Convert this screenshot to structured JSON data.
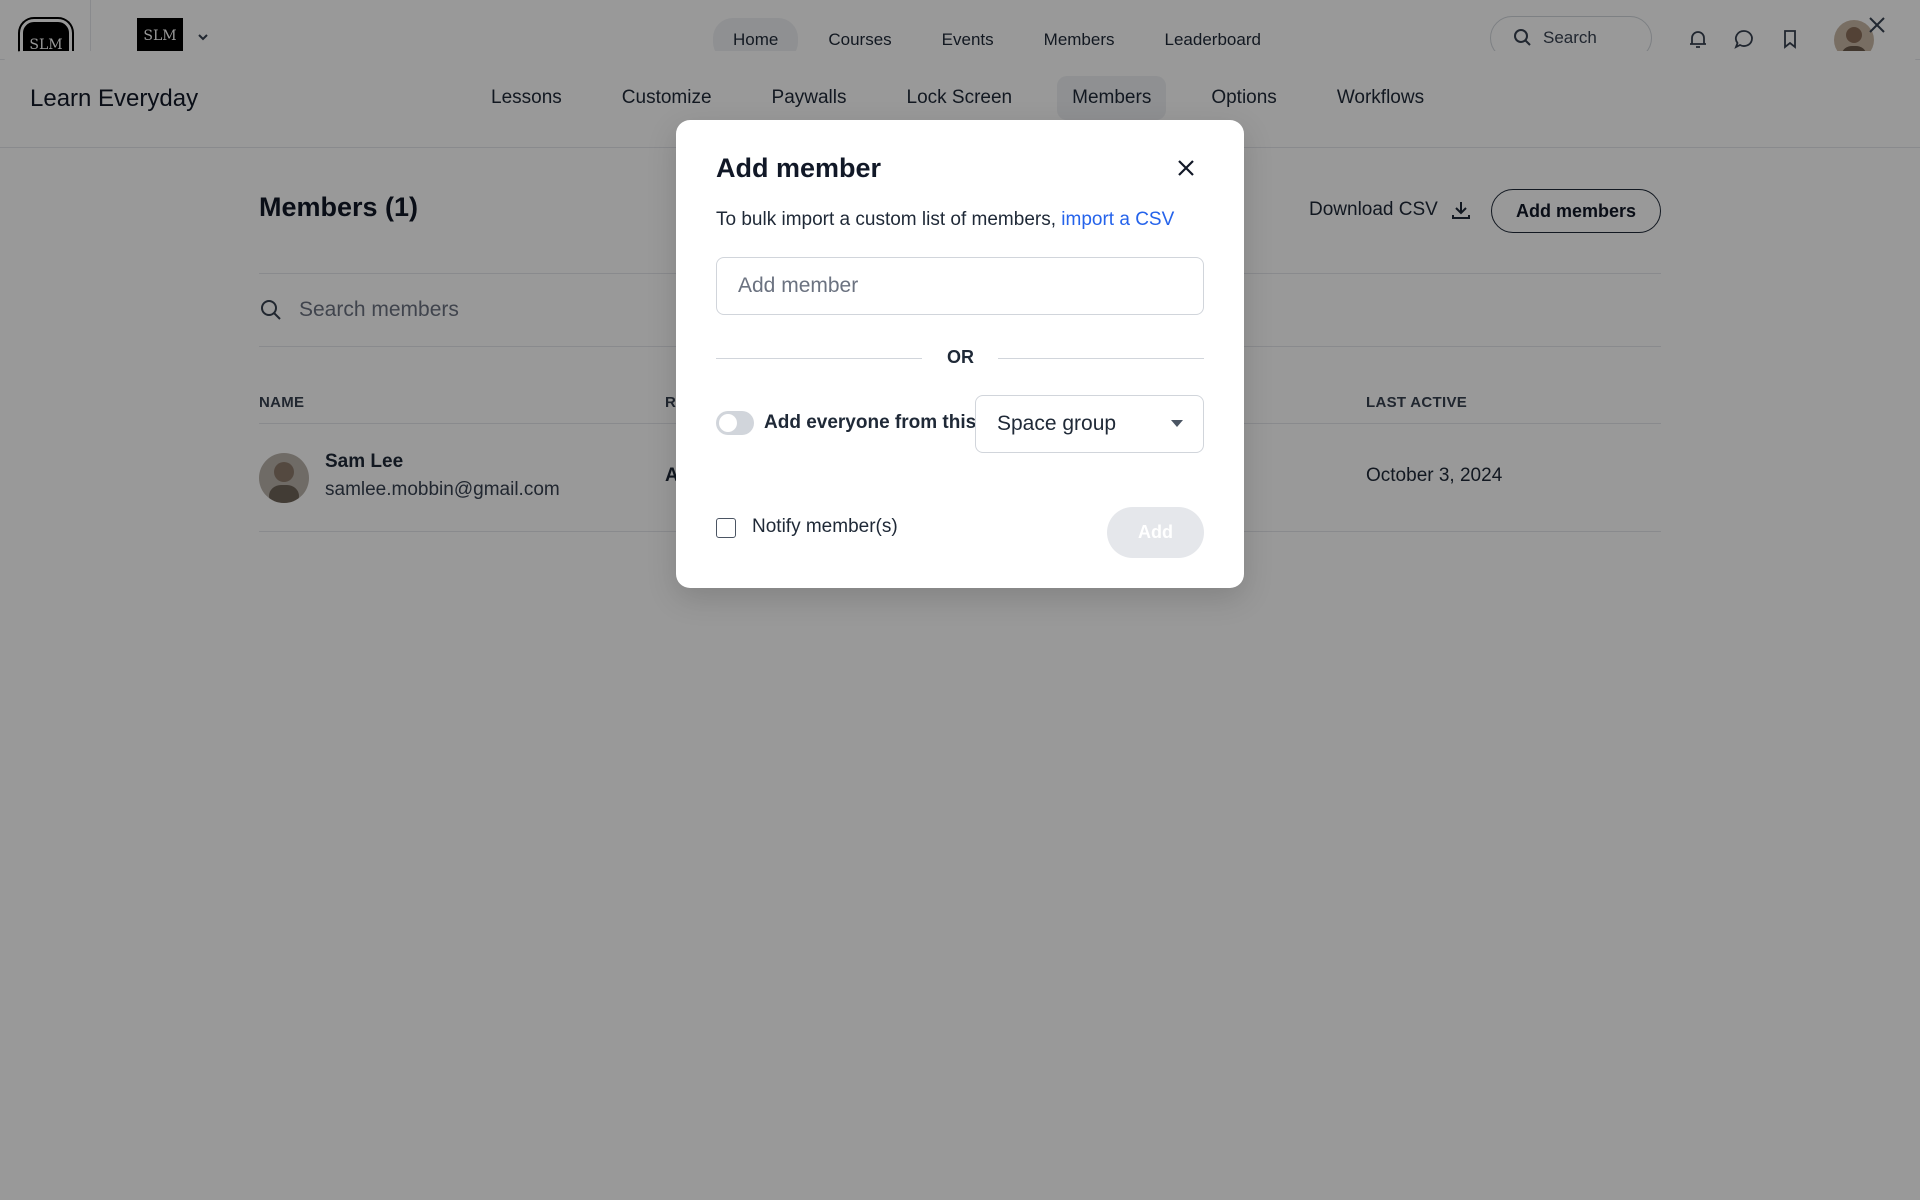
{
  "topbar": {
    "logo_text": "SLM",
    "brand_text": "SLM",
    "nav": [
      "Home",
      "Courses",
      "Events",
      "Members",
      "Leaderboard"
    ],
    "active_nav": "Home",
    "search_label": "Search"
  },
  "sheet": {
    "space_title": "Learn Everyday",
    "tabs": [
      "Lessons",
      "Customize",
      "Paywalls",
      "Lock Screen",
      "Members",
      "Options",
      "Workflows"
    ],
    "active_tab": "Members"
  },
  "members": {
    "title": "Members (1)",
    "download_csv": "Download CSV",
    "add_members": "Add members",
    "search_placeholder": "Search members",
    "columns": {
      "name": "NAME",
      "role": "R",
      "last_active": "LAST ACTIVE"
    },
    "rows": [
      {
        "name": "Sam Lee",
        "email": "samlee.mobbin@gmail.com",
        "role": "A",
        "last_active": "October 3, 2024"
      }
    ]
  },
  "modal": {
    "title": "Add member",
    "hint_prefix": "To bulk import a custom list of members,",
    "hint_link": "import a CSV",
    "input_placeholder": "Add member",
    "or_text": "OR",
    "toggle_label": "Add everyone from this",
    "select_value": "Space group",
    "notify_label": "Notify member(s)",
    "add_button": "Add"
  },
  "colors": {
    "link": "#2563eb",
    "overlay": "rgba(0,0,0,0.4)",
    "disabled_button": "#e5e7eb"
  }
}
